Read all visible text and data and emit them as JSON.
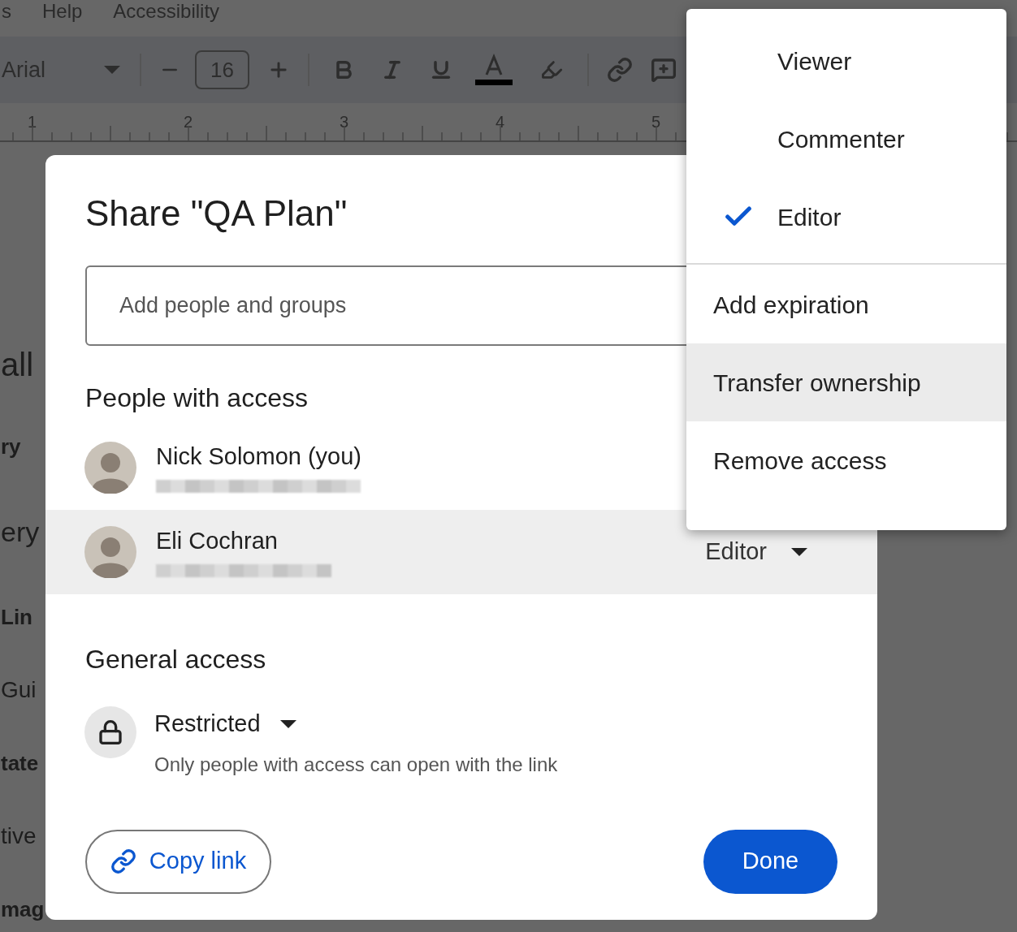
{
  "background_document": {
    "menu_bar": [
      "s",
      "Help",
      "Accessibility"
    ],
    "toolbar": {
      "font": "Arial",
      "font_size": "16"
    },
    "ruler_numbers": [
      "1",
      "2",
      "3",
      "4",
      "5"
    ],
    "page_fragments": [
      {
        "text": "all",
        "kind": "title"
      },
      {
        "text": "ry",
        "kind": "bold"
      },
      {
        "text": "ery",
        "kind": "subtitle"
      },
      {
        "text": "Lin",
        "kind": "bold"
      },
      {
        "text": "Gui",
        "kind": "normal"
      },
      {
        "text": "tate",
        "kind": "bold"
      },
      {
        "text": "tive",
        "kind": "normal"
      },
      {
        "text": "mag",
        "kind": "bold"
      }
    ]
  },
  "dialog": {
    "title": "Share \"QA Plan\"",
    "add_field": {
      "placeholder": "Add people and groups"
    },
    "people_heading": "People with access",
    "people": [
      {
        "name": "Nick Solomon (you)",
        "highlighted": false
      },
      {
        "name": "Eli Cochran",
        "highlighted": true,
        "role": "Editor"
      }
    ],
    "general_heading": "General access",
    "general_access": {
      "setting": "Restricted",
      "description": "Only people with access can open with the link"
    },
    "copy_link": "Copy link",
    "done": "Done"
  },
  "role_menu": {
    "roles": [
      {
        "label": "Viewer",
        "selected": false
      },
      {
        "label": "Commenter",
        "selected": false
      },
      {
        "label": "Editor",
        "selected": true
      }
    ],
    "actions": [
      {
        "label": "Add expiration",
        "highlighted": false
      },
      {
        "label": "Transfer ownership",
        "highlighted": true
      },
      {
        "label": "Remove access",
        "highlighted": false
      }
    ]
  }
}
